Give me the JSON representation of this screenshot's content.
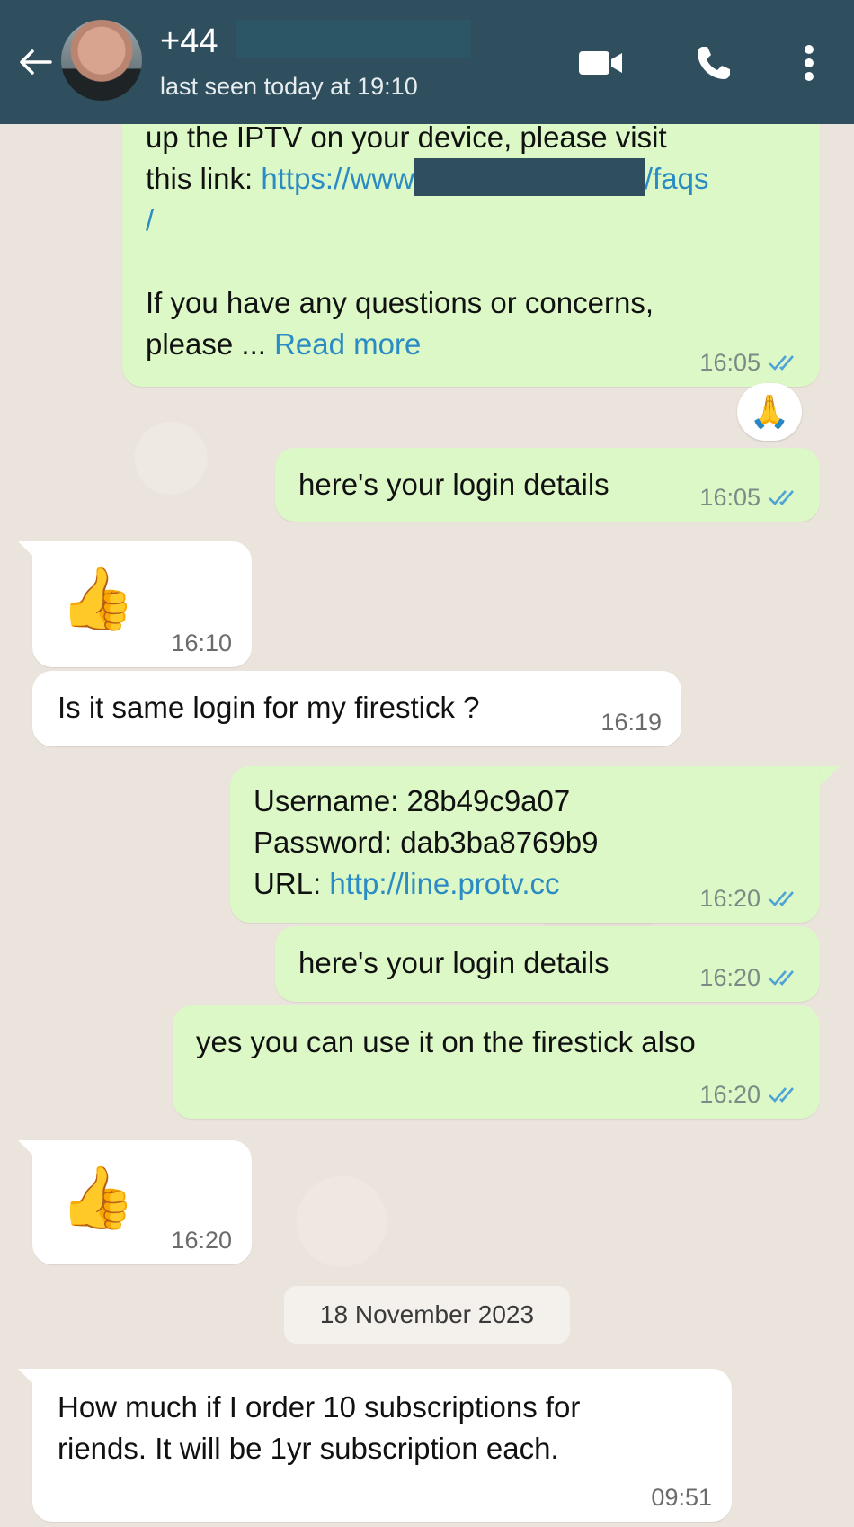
{
  "header": {
    "contact_name": "+44",
    "last_seen": "last seen today at 19:10",
    "icons": [
      "back-arrow-icon",
      "video-call-icon",
      "voice-call-icon",
      "more-options-icon"
    ]
  },
  "messages": [
    {
      "direction": "out",
      "text_top": "up the IPTV on your device, please visit",
      "text_link_prefix": "this link: ",
      "link_start": "https://www",
      "link_end": "/faqs",
      "link_slash": "/",
      "text_after": "If you have any questions or concerns,",
      "text_please": "please ... ",
      "read_more": "Read more",
      "time": "16:05",
      "reaction": "🙏"
    },
    {
      "direction": "out",
      "text": "here's your login details",
      "time": "16:05"
    },
    {
      "direction": "in",
      "emoji": "👍",
      "time": "16:10"
    },
    {
      "direction": "in",
      "text": "Is it same login for my firestick ?",
      "time": "16:19"
    },
    {
      "direction": "out",
      "username_line": "Username: 28b49c9a07",
      "password_line": "Password: dab3ba8769b9",
      "url_label": "URL: ",
      "url": "http://line.protv.cc",
      "time": "16:20"
    },
    {
      "direction": "out",
      "text": "here's your login details",
      "time": "16:20"
    },
    {
      "direction": "out",
      "text": "yes you can use it on the firestick also",
      "time": "16:20"
    },
    {
      "direction": "in",
      "emoji": "👍",
      "time": "16:20"
    },
    {
      "date_divider": "18 November 2023"
    },
    {
      "direction": "in",
      "text": "How much if I order 10 subscriptions for\nriends. It will be 1yr subscription each.",
      "time": "09:51"
    }
  ],
  "colors": {
    "header_bg": "#2f4f5e",
    "outgoing_bubble": "#dcf8c6",
    "incoming_bubble": "#ffffff",
    "link": "#2b8bc4",
    "read_ticks": "#4fa3d8",
    "chat_bg": "#ebe4dc"
  }
}
